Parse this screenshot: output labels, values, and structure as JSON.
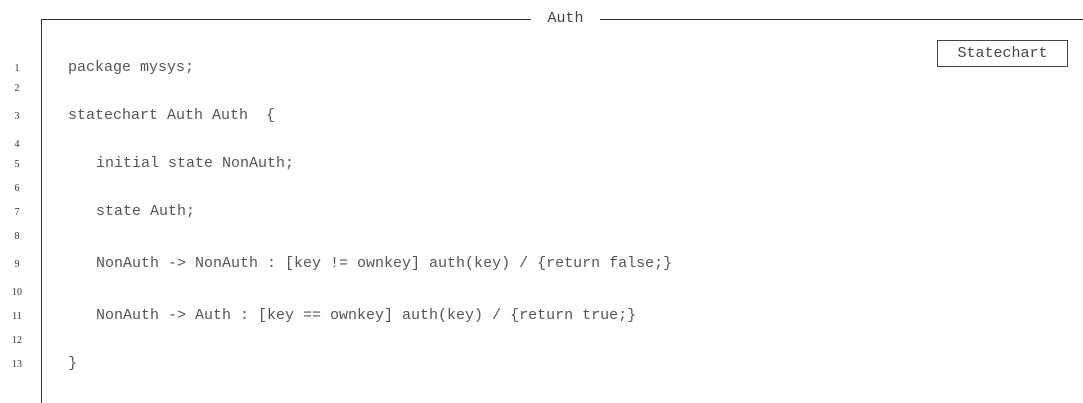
{
  "listing": {
    "title": "Auth",
    "badge": "Statechart",
    "line_numbers": [
      "1",
      "2",
      "3",
      "4",
      "5",
      "6",
      "7",
      "8",
      "9",
      "10",
      "11",
      "12",
      "13"
    ],
    "code": [
      "package mysys;",
      "statechart Auth Auth  {",
      "initial state NonAuth;",
      "state Auth;",
      "NonAuth -> NonAuth : [key != ownkey] auth(key) / {return false;}",
      "NonAuth -> Auth : [key == ownkey] auth(key) / {return true;}",
      "}"
    ]
  }
}
